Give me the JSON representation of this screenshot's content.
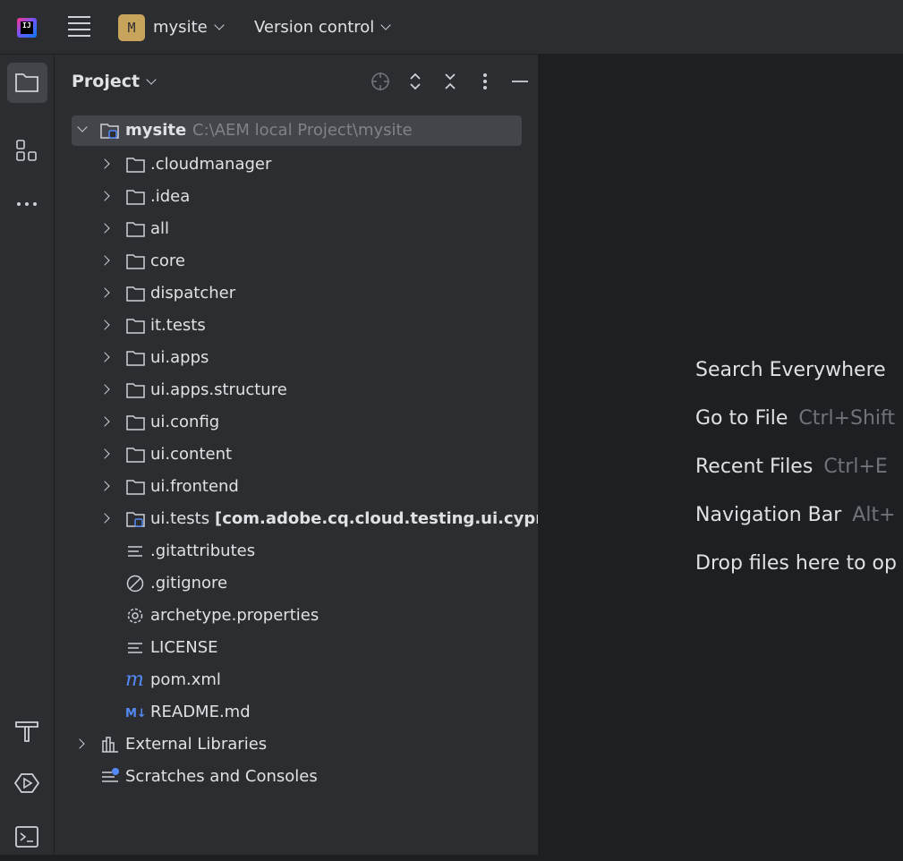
{
  "titlebar": {
    "logo_text": "IJ",
    "project_badge": "M",
    "project_name": "mysite",
    "vcs_label": "Version control"
  },
  "toolstrip": {
    "items": [
      "project-icon",
      "structure-icon",
      "more-icon",
      "build-icon",
      "run-icon",
      "terminal-icon"
    ]
  },
  "panel": {
    "title": "Project"
  },
  "tree": {
    "root": {
      "label": "mysite",
      "path": "C:\\AEM local Project\\mysite"
    },
    "folders": [
      ".cloudmanager",
      ".idea",
      "all",
      "core",
      "dispatcher",
      "it.tests",
      "ui.apps",
      "ui.apps.structure",
      "ui.config",
      "ui.content",
      "ui.frontend"
    ],
    "module": {
      "label": "ui.tests",
      "extra": "[com.adobe.cq.cloud.testing.ui.cypr"
    },
    "files": [
      {
        "label": ".gitattributes",
        "icon": "text-file-icon"
      },
      {
        "label": ".gitignore",
        "icon": "ignore-file-icon"
      },
      {
        "label": "archetype.properties",
        "icon": "settings-file-icon"
      },
      {
        "label": "LICENSE",
        "icon": "text-file-icon"
      },
      {
        "label": "pom.xml",
        "icon": "maven-icon"
      },
      {
        "label": "README.md",
        "icon": "markdown-icon"
      }
    ],
    "external_libraries": "External Libraries",
    "scratches": "Scratches and Consoles"
  },
  "editor": {
    "hints": [
      {
        "label": "Search Everywhere",
        "key": ""
      },
      {
        "label": "Go to File",
        "key": "Ctrl+Shift"
      },
      {
        "label": "Recent Files",
        "key": "Ctrl+E"
      },
      {
        "label": "Navigation Bar",
        "key": "Alt+"
      },
      {
        "label": "Drop files here to op",
        "key": ""
      }
    ]
  },
  "colors": {
    "background": "#1e1f22",
    "panel": "#2b2d30",
    "selection": "#43454a",
    "badge": "#c7a35b",
    "accent_blue": "#548af7"
  }
}
